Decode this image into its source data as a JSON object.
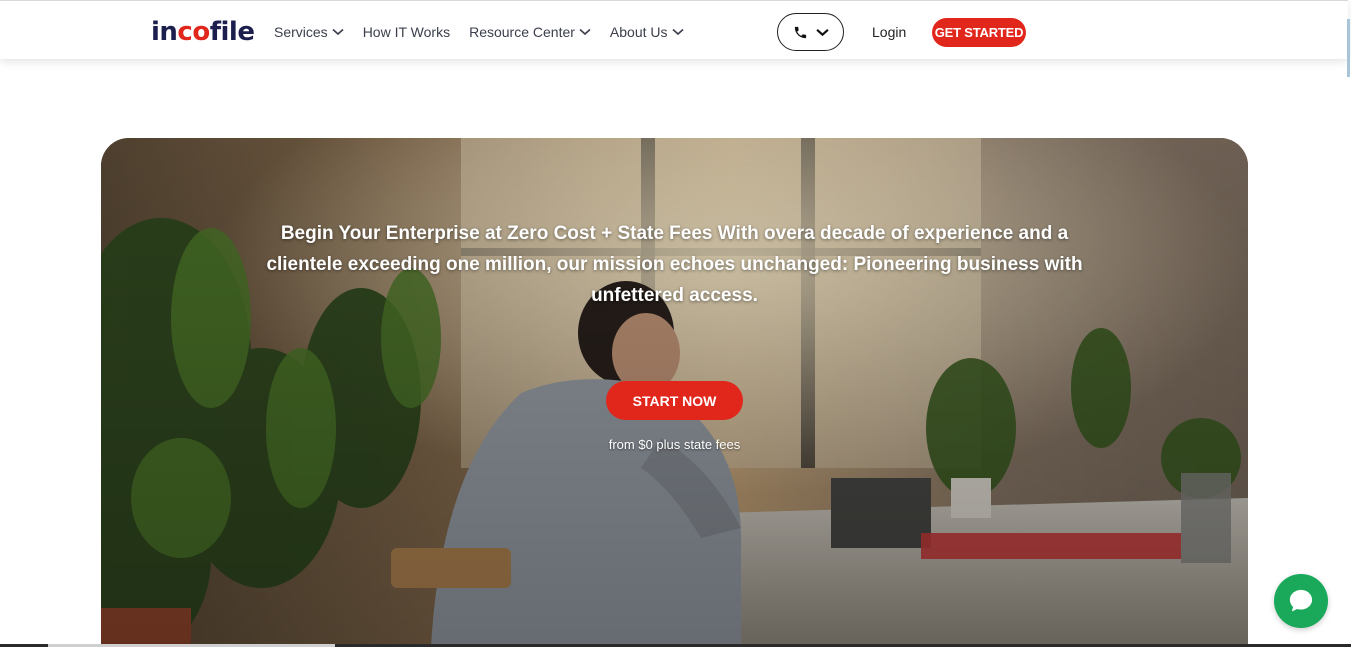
{
  "header": {
    "logo": {
      "part1": "in",
      "part2": "co",
      "part3": "file"
    },
    "nav": [
      {
        "label": "Services",
        "dropdown": true
      },
      {
        "label": "How IT Works",
        "dropdown": false
      },
      {
        "label": "Resource Center",
        "dropdown": true
      },
      {
        "label": "About Us",
        "dropdown": true
      }
    ],
    "phone_icon": "phone-icon",
    "login_label": "Login",
    "cta_label": "GET STARTED"
  },
  "hero": {
    "headline": "Begin Your Enterprise at Zero Cost + State Fees With overa decade of experience and a clientele exceeding one million, our mission echoes unchanged: Pioneering business with unfettered access.",
    "button_label": "START NOW",
    "note": "from $0 plus state fees"
  },
  "chat_icon": "chat-bubble-icon",
  "colors": {
    "brand_navy": "#1c1f4e",
    "accent_red": "#e1261c",
    "chat_green": "#1aa95b"
  }
}
